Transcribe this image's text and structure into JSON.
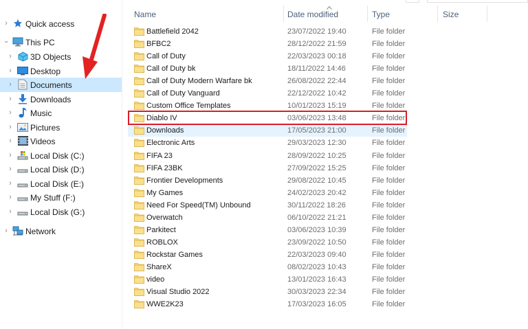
{
  "sidebar": {
    "quick_access": "Quick access",
    "this_pc": "This PC",
    "items": [
      {
        "label": "3D Objects",
        "icon": "3d-objects-icon"
      },
      {
        "label": "Desktop",
        "icon": "desktop-icon"
      },
      {
        "label": "Documents",
        "icon": "documents-icon",
        "selected": true
      },
      {
        "label": "Downloads",
        "icon": "downloads-icon"
      },
      {
        "label": "Music",
        "icon": "music-icon"
      },
      {
        "label": "Pictures",
        "icon": "pictures-icon"
      },
      {
        "label": "Videos",
        "icon": "videos-icon"
      },
      {
        "label": "Local Disk (C:)",
        "icon": "drive-c-icon"
      },
      {
        "label": "Local Disk (D:)",
        "icon": "drive-icon"
      },
      {
        "label": "Local Disk (E:)",
        "icon": "drive-icon"
      },
      {
        "label": "My Stuff (F:)",
        "icon": "drive-icon"
      },
      {
        "label": "Local Disk (G:)",
        "icon": "drive-icon"
      }
    ],
    "network": "Network"
  },
  "columns": {
    "name": "Name",
    "date": "Date modified",
    "type": "Type",
    "size": "Size"
  },
  "files": [
    {
      "name": "Battlefield 2042",
      "date": "23/07/2022 19:40",
      "type": "File folder"
    },
    {
      "name": "BFBC2",
      "date": "28/12/2022 21:59",
      "type": "File folder"
    },
    {
      "name": "Call of Duty",
      "date": "22/03/2023 00:18",
      "type": "File folder"
    },
    {
      "name": "Call of Duty bk",
      "date": "18/11/2022 14:46",
      "type": "File folder"
    },
    {
      "name": "Call of Duty Modern Warfare bk",
      "date": "26/08/2022 22:44",
      "type": "File folder"
    },
    {
      "name": "Call of Duty Vanguard",
      "date": "22/12/2022 10:42",
      "type": "File folder"
    },
    {
      "name": "Custom Office Templates",
      "date": "10/01/2023 15:19",
      "type": "File folder"
    },
    {
      "name": "Diablo IV",
      "date": "03/06/2023 13:48",
      "type": "File folder"
    },
    {
      "name": "Downloads",
      "date": "17/05/2023 21:00",
      "type": "File folder"
    },
    {
      "name": "Electronic Arts",
      "date": "29/03/2023 12:30",
      "type": "File folder"
    },
    {
      "name": "FIFA 23",
      "date": "28/09/2022 10:25",
      "type": "File folder"
    },
    {
      "name": "FIFA 23BK",
      "date": "27/09/2022 15:25",
      "type": "File folder"
    },
    {
      "name": "Frontier Developments",
      "date": "29/08/2022 10:45",
      "type": "File folder"
    },
    {
      "name": "My Games",
      "date": "24/02/2023 20:42",
      "type": "File folder"
    },
    {
      "name": "Need For Speed(TM) Unbound",
      "date": "30/11/2022 18:26",
      "type": "File folder"
    },
    {
      "name": "Overwatch",
      "date": "06/10/2022 21:21",
      "type": "File folder"
    },
    {
      "name": "Parkitect",
      "date": "03/06/2023 10:39",
      "type": "File folder"
    },
    {
      "name": "ROBLOX",
      "date": "23/09/2022 10:50",
      "type": "File folder"
    },
    {
      "name": "Rockstar Games",
      "date": "22/03/2023 09:40",
      "type": "File folder"
    },
    {
      "name": "ShareX",
      "date": "08/02/2023 10:43",
      "type": "File folder"
    },
    {
      "name": "video",
      "date": "13/01/2023 16:43",
      "type": "File folder"
    },
    {
      "name": "Visual Studio 2022",
      "date": "30/03/2023 22:34",
      "type": "File folder"
    },
    {
      "name": "WWE2K23",
      "date": "17/03/2023 16:05",
      "type": "File folder"
    }
  ],
  "colors": {
    "selected_bg": "#cce8ff",
    "hover_bg": "#e5f3ff",
    "highlight_box": "#d71e2a",
    "folder": "#f8d775",
    "arrow": "#e32222"
  }
}
